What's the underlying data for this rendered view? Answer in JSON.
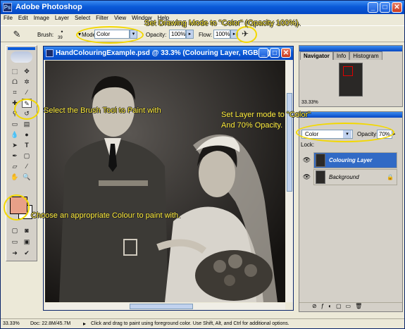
{
  "app": {
    "title": "Adobe Photoshop"
  },
  "menu": [
    "File",
    "Edit",
    "Image",
    "Layer",
    "Select",
    "Filter",
    "View",
    "Window",
    "Help"
  ],
  "options": {
    "brush_label": "Brush:",
    "brush_size": "39",
    "mode_label": "Mode:",
    "mode_value": "Color",
    "opacity_label": "Opacity:",
    "opacity_value": "100%",
    "flow_label": "Flow:",
    "flow_value": "100%"
  },
  "document": {
    "title": "HandColouringExample.psd @ 33.3% (Colouring Layer, RGB/8#)"
  },
  "navigator": {
    "tabs": [
      "Navigator",
      "Info",
      "Histogram"
    ],
    "zoom": "33.33%"
  },
  "layers": {
    "mode": "Color",
    "opacity_label": "Opacity:",
    "opacity_value": "70%",
    "lock_label": "Lock:",
    "items": [
      "Colouring Layer",
      "Background"
    ]
  },
  "status": {
    "zoom": "33.33%",
    "doc": "Doc: 22.8M/45.7M",
    "hint": "Click and drag to paint using foreground color. Use Shift, Alt, and Ctrl for additional options."
  },
  "annotations": {
    "drawing_mode": "Set Drawing Mode to \"Color\" (Opacity 100%).",
    "brush_tool": "Select the Brush Tool to Paint with",
    "layer_mode_1": "Set Layer mode to \"Color\"",
    "layer_mode_2": "And 70% Opacity.",
    "colour": "Choose an appropriate Colour to paint with."
  },
  "colors": {
    "accent": "#0a5ad8",
    "callout": "#ffec3a",
    "foreground_swatch": "#e8a088"
  }
}
